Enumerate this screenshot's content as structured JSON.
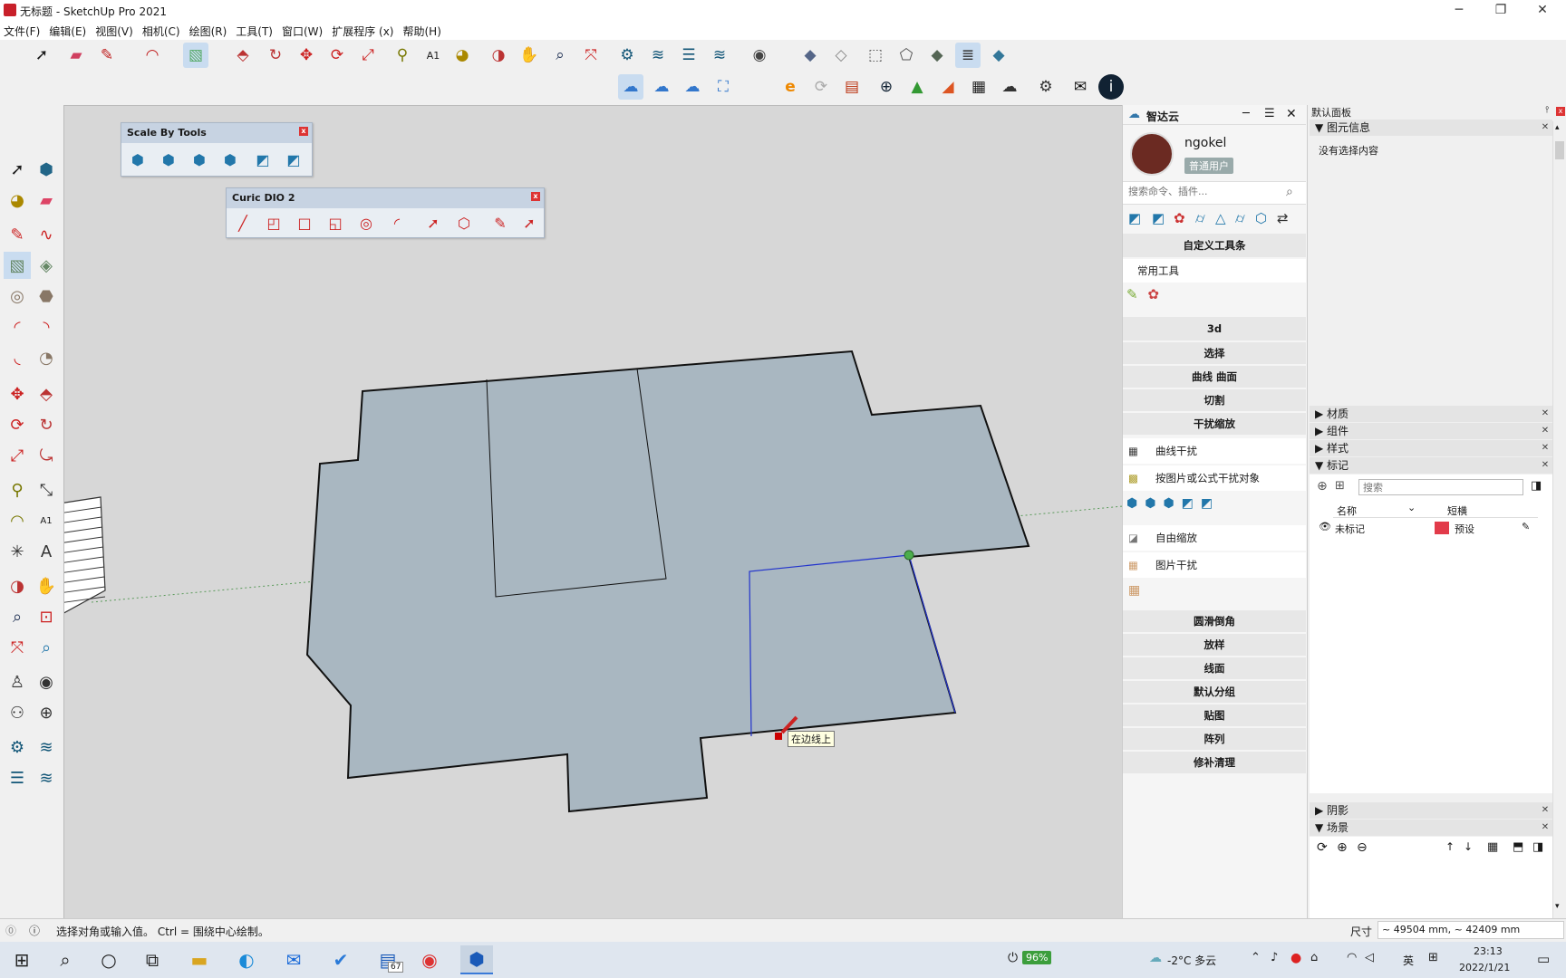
{
  "window": {
    "title": "无标题 - SketchUp Pro 2021",
    "min": "─",
    "max": "❐",
    "close": "✕"
  },
  "menu": [
    "文件(F)",
    "编辑(E)",
    "视图(V)",
    "相机(C)",
    "绘图(R)",
    "工具(T)",
    "窗口(W)",
    "扩展程序 (x)",
    "帮助(H)"
  ],
  "toolbar1_icons": [
    "select-arrow",
    "eraser",
    "pencil",
    "arc",
    "rectangle",
    "push-pull",
    "follow-me",
    "move",
    "rotate",
    "scale",
    "tape",
    "text",
    "paint",
    "orbit",
    "pan",
    "zoom",
    "zoom-extents",
    "extension",
    "layers",
    "solid",
    "sandbox",
    "user",
    "shape",
    "shape",
    "shape",
    "shape",
    "shape",
    "shape",
    "shape"
  ],
  "scale_by_tools": {
    "title": "Scale By Tools",
    "close": "x"
  },
  "curic": {
    "title": "Curic DIO 2",
    "close": "x"
  },
  "zhida": {
    "title": "智达云",
    "username": "ngokel",
    "badge": "普通用户",
    "search_placeholder": "搜索命令、插件...",
    "custom_toolset": "自定义工具条",
    "common_tools": "常用工具",
    "sections": [
      "3d",
      "选择",
      "曲线 曲面",
      "切割",
      "干扰缩放"
    ],
    "items": [
      "曲线干扰",
      "按图片或公式干扰对象",
      "自由缩放",
      "图片干扰"
    ],
    "sections2": [
      "圆滑倒角",
      "放样",
      "线面",
      "默认分组",
      "贴图",
      "阵列",
      "修补清理"
    ]
  },
  "tray": {
    "title": "默认面板",
    "entity_info": "图元信息",
    "no_selection": "没有选择内容",
    "panels": [
      "材质",
      "组件",
      "样式",
      "标记"
    ],
    "tag_search_placeholder": "搜索",
    "col_name": "名称",
    "col_dash": "短横",
    "tag_row": {
      "name": "未标记",
      "dash": "预设",
      "color": "#e23b4a"
    },
    "shadow": "阴影",
    "scenes": "场景"
  },
  "viewport": {
    "tooltip": "在边线上"
  },
  "status": {
    "hint": "选择对角或输入值。 Ctrl = 围绕中心绘制。",
    "measure_label": "尺寸",
    "measure_value": "~ 49504 mm, ~ 42409 mm"
  },
  "taskbar": {
    "battery": "96%",
    "weather": "-2°C  多云",
    "ime": "英",
    "time": "23:13",
    "date": "2022/1/21",
    "badge": "67"
  }
}
